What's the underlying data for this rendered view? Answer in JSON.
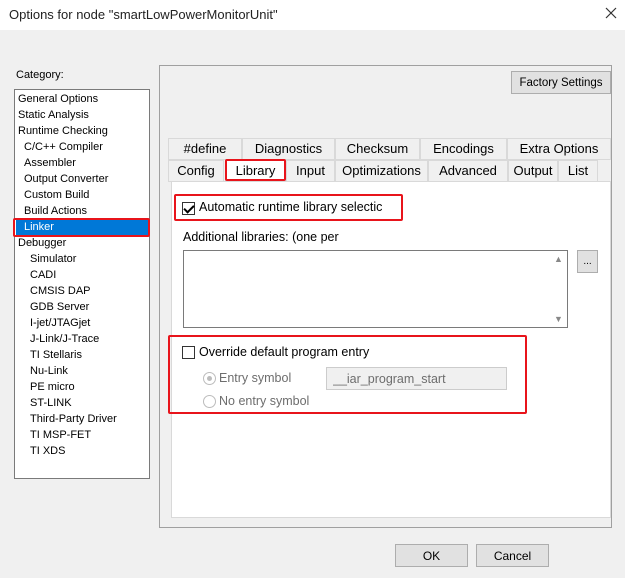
{
  "window": {
    "title": "Options for node \"smartLowPowerMonitorUnit\""
  },
  "category": {
    "label": "Category:",
    "items": [
      {
        "label": "General Options"
      },
      {
        "label": "Static Analysis"
      },
      {
        "label": "Runtime Checking"
      },
      {
        "label": "C/C++ Compiler"
      },
      {
        "label": "Assembler"
      },
      {
        "label": "Output Converter"
      },
      {
        "label": "Custom Build"
      },
      {
        "label": "Build Actions"
      },
      {
        "label": "Linker",
        "selected": true
      },
      {
        "label": "Debugger"
      },
      {
        "label": "Simulator"
      },
      {
        "label": "CADI"
      },
      {
        "label": "CMSIS DAP"
      },
      {
        "label": "GDB Server"
      },
      {
        "label": "I-jet/JTAGjet"
      },
      {
        "label": "J-Link/J-Trace"
      },
      {
        "label": "TI Stellaris"
      },
      {
        "label": "Nu-Link"
      },
      {
        "label": "PE micro"
      },
      {
        "label": "ST-LINK"
      },
      {
        "label": "Third-Party Driver"
      },
      {
        "label": "TI MSP-FET"
      },
      {
        "label": "TI XDS"
      }
    ]
  },
  "factory_settings_label": "Factory Settings",
  "tabs_row1": [
    {
      "label": "#define"
    },
    {
      "label": "Diagnostics"
    },
    {
      "label": "Checksum"
    },
    {
      "label": "Encodings"
    },
    {
      "label": "Extra Options"
    }
  ],
  "tabs_row2": [
    {
      "label": "Config"
    },
    {
      "label": "Library",
      "active": true
    },
    {
      "label": "Input"
    },
    {
      "label": "Optimizations"
    },
    {
      "label": "Advanced"
    },
    {
      "label": "Output"
    },
    {
      "label": "List"
    }
  ],
  "library": {
    "auto_runtime_label": "Automatic runtime library selectic",
    "auto_runtime_checked": true,
    "additional_label": "Additional libraries: (one per",
    "ellipsis_label": "...",
    "override_label": "Override default program entry",
    "override_checked": false,
    "entry_symbol_label": "Entry symbol",
    "entry_symbol_value": "__iar_program_start",
    "no_entry_label": "No entry symbol"
  },
  "buttons": {
    "ok": "OK",
    "cancel": "Cancel"
  },
  "colors": {
    "highlight_red": "#e8141b",
    "selection_blue": "#0078d7"
  }
}
